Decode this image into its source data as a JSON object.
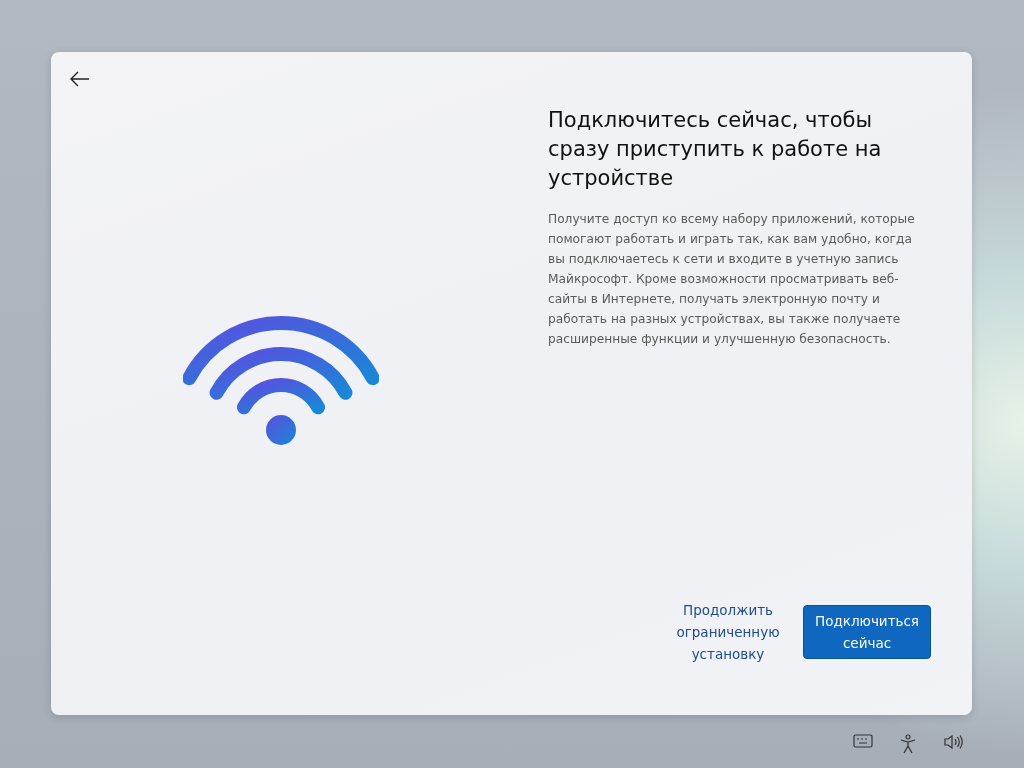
{
  "title": "Подключитесь сейчас, чтобы сразу приступить к работе на устройстве",
  "description": "Получите доступ ко всему набору приложений, которые помогают работать и играть так, как вам удобно, когда вы подключаетесь к сети и входите в учетную запись Майкрософт. Кроме возможности просматривать веб-сайты в Интернете, получать электронную почту и работать на разных устройствах, вы также получаете расширенные функции и улучшенную безопасность.",
  "buttons": [
    {
      "label": "Продолжить ограниченную установку",
      "kind": "link"
    },
    {
      "label": "Подключиться сейчас",
      "kind": "primary"
    }
  ]
}
